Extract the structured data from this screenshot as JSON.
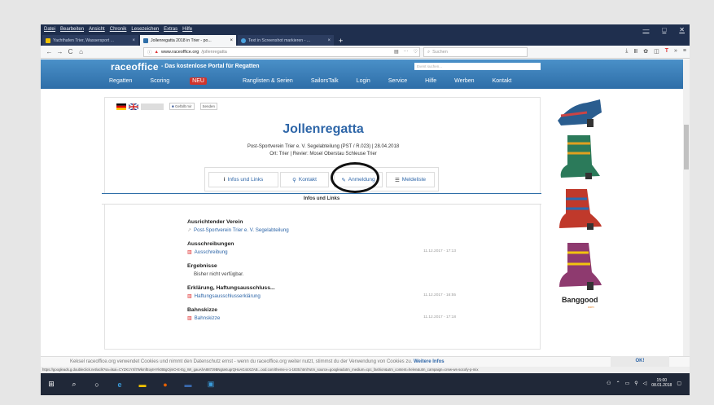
{
  "menubar": {
    "items": [
      "Datei",
      "Bearbeiten",
      "Ansicht",
      "Chronik",
      "Lesezeichen",
      "Extras",
      "Hilfe"
    ],
    "controls": [
      "—",
      "□",
      "✕"
    ]
  },
  "tabs": [
    {
      "label": "Yachthafen Trier, Wassersport ...",
      "active": false
    },
    {
      "label": "Jollenregatta 2018 in Trier - po...",
      "active": true
    },
    {
      "label": "Text in Screenshot markieren - ...",
      "active": false
    }
  ],
  "newtab": "+",
  "nav": {
    "back": "←",
    "forward": "→",
    "reload": "C",
    "home": "⌂",
    "url_host": "www.raceoffice.org",
    "url_path": "/jollenregatta",
    "search_placeholder": "Suchen"
  },
  "site": {
    "logo": "raceoffice",
    "tagline": "- Das kostenlose Portal für Regatten",
    "event_search": "Event suchen...",
    "nav": [
      "Regatten",
      "Scoring",
      "Ranglisten & Serien",
      "SailorsTalk",
      "Login",
      "Service",
      "Hilfe",
      "Werben",
      "Kontakt"
    ],
    "scoring_badge": "NEU"
  },
  "event": {
    "like": "Gefällt mir",
    "send": "Senden",
    "title": "Jollenregatta",
    "line1": "Post-Sportverein Trier e. V. Segelabteilung (PST / R.023) | 28.04.2018",
    "line2": "Ort: Trier | Revier: Mosel Oberstau Schleuse Trier",
    "tabs": [
      "Infos und Links",
      "Kontakt",
      "Anmeldung",
      "Meldeliste"
    ],
    "section_title": "Infos und Links"
  },
  "sections": [
    {
      "heading": "Ausrichtender Verein",
      "link": "Post-Sportverein Trier e. V. Segelabteilung",
      "date": ""
    },
    {
      "heading": "Ausschreibungen",
      "link": "Ausschreibung",
      "date": "11.12.2017 - 17:13"
    },
    {
      "heading": "Ergebnisse",
      "text": "Bisher nicht verfügbar."
    },
    {
      "heading": "Erklärung, Haftungsausschluss...",
      "link": "Haftungsausschlusserklärung",
      "date": "11.12.2017 - 16:55"
    },
    {
      "heading": "Bahnskizze",
      "link": "Bahnskizze",
      "date": "11.12.2017 - 17:18"
    }
  ],
  "ad": {
    "brand": "Banggood",
    "brand_sub": "com"
  },
  "cookie": {
    "text": "Keksel raceoffice.org verwendet Cookies und nimmt den Datenschutz ernst - wenn du raceoffice.org weiter nutzt, stimmst du der Verwendung von Cookies zu.",
    "link": "Weitere Infos",
    "ok": "OK!"
  },
  "status_url": "https://googleads.g.doubleclick.net/aclk?sa=l&ai=CYZK1YXl7WkmfEoyIHYk0tBgOjmO-E-Eg_WI_gauAhA887z9BNgIaKugrQHoAG44XZAB...ood.com/theme-x-1-1835.html?utm_source=googleadutm_medium=cpc_fashion&utm_content=helen&utm_campaign=crew-ws-socofy-p-mix",
  "taskbar": {
    "time": "15:00",
    "date": "08.01.2018"
  },
  "colors": {
    "accent": "#2e66a8",
    "header": "#3a80bc"
  }
}
